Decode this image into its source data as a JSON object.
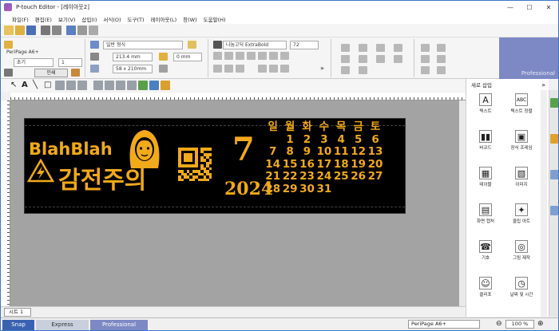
{
  "window": {
    "title": "P-touch Editor - [레이아웃2]",
    "controls": [
      "—",
      "☐",
      "✕"
    ]
  },
  "menu": [
    "파일(F)",
    "편집(E)",
    "보기(V)",
    "삽입(I)",
    "서식(O)",
    "도구(T)",
    "레이아웃(L)",
    "창(W)",
    "도움말(H)"
  ],
  "property": {
    "printer": "PeriPage A6+",
    "length": "1",
    "print_label": "인쇄",
    "paper_format": "일반 형식",
    "width_value": "213.4 mm",
    "margin_value": "0 mm",
    "size_value": "58 x 210mm",
    "font_name": "나눔고딕 ExtraBold",
    "font_size": "72"
  },
  "mode_tab_label": "Professional",
  "pane": {
    "title": "새로 삽입",
    "items": [
      {
        "label": "텍스트",
        "icon": "A"
      },
      {
        "label": "텍스트 정렬",
        "icon": "ABC"
      },
      {
        "label": "바코드",
        "icon": "▮▮"
      },
      {
        "label": "장식 프레임",
        "icon": "▣"
      },
      {
        "label": "테이블",
        "icon": "▦"
      },
      {
        "label": "이미지",
        "icon": "▧"
      },
      {
        "label": "화면 캡처",
        "icon": "▤"
      },
      {
        "label": "클립 아트",
        "icon": "✦"
      },
      {
        "label": "기호",
        "icon": "☎"
      },
      {
        "label": "그림 제작",
        "icon": "◎"
      },
      {
        "label": "클리포",
        "icon": "☺"
      },
      {
        "label": "날짜 및 시간",
        "icon": "◷"
      }
    ]
  },
  "label": {
    "name_text": "BlahBlah",
    "caution_text": "감전주의",
    "month": "7",
    "year": "2024",
    "weekdays": [
      "일",
      "월",
      "화",
      "수",
      "목",
      "금",
      "토"
    ],
    "weeks": [
      [
        "",
        "1",
        "2",
        "3",
        "4",
        "5",
        "6"
      ],
      [
        "7",
        "8",
        "9",
        "10",
        "11",
        "12",
        "13"
      ],
      [
        "14",
        "15",
        "16",
        "17",
        "18",
        "19",
        "20"
      ],
      [
        "21",
        "22",
        "23",
        "24",
        "25",
        "26",
        "27"
      ],
      [
        "28",
        "29",
        "30",
        "31",
        "",
        "",
        ""
      ]
    ],
    "accent_color": "#f2a91a"
  },
  "sheet_tab": "시트 1",
  "status": {
    "modes": [
      "Snap",
      "Express",
      "Professional"
    ],
    "printer": "PeriPage A6+",
    "zoom": "100 %"
  }
}
